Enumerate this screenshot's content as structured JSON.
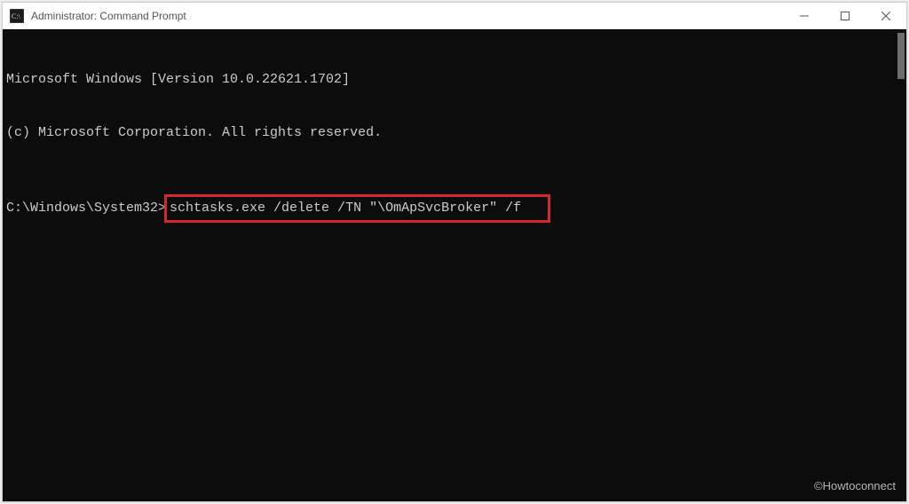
{
  "window": {
    "title": "Administrator: Command Prompt"
  },
  "terminal": {
    "line1": "Microsoft Windows [Version 10.0.22621.1702]",
    "line2": "(c) Microsoft Corporation. All rights reserved.",
    "prompt": "C:\\Windows\\System32>",
    "command": "schtasks.exe /delete /TN \"\\OmApSvcBroker\" /f"
  },
  "watermark": "©Howtoconnect"
}
